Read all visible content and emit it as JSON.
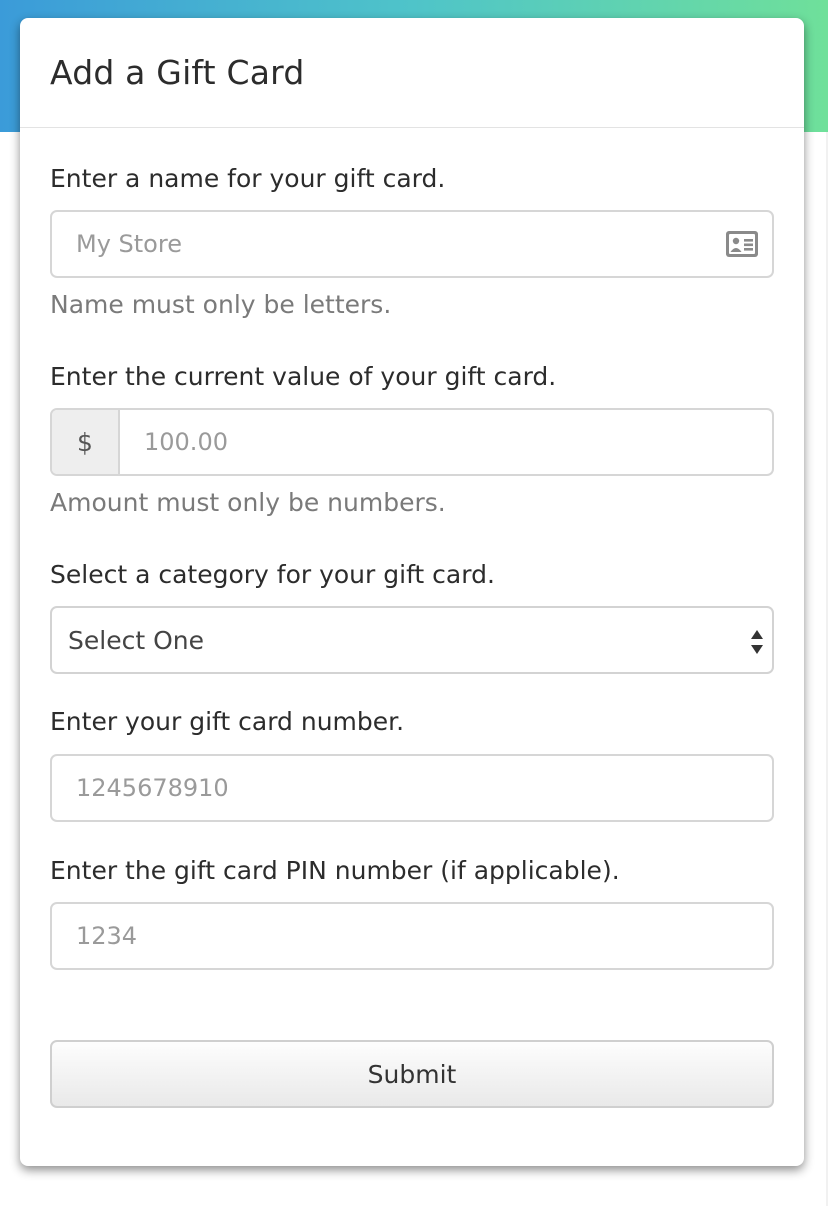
{
  "card": {
    "title": "Add a Gift Card"
  },
  "form": {
    "name": {
      "label": "Enter a name for your gift card.",
      "placeholder": "My Store",
      "icon": "id-card-icon",
      "help": "Name must only be letters."
    },
    "value": {
      "label": "Enter the current value of your gift card.",
      "addon": "$",
      "placeholder": "100.00",
      "help": "Amount must only be numbers."
    },
    "category": {
      "label": "Select a category for your gift card.",
      "selected": "Select One"
    },
    "number": {
      "label": "Enter your gift card number.",
      "placeholder": "1245678910"
    },
    "pin": {
      "label": "Enter the gift card PIN number (if applicable).",
      "placeholder": "1234"
    },
    "submit_label": "Submit"
  },
  "colors": {
    "gradient_start": "#3b9bd9",
    "gradient_end": "#6fe09a",
    "border": "#d6d6d6",
    "help_text": "#7a7a7a"
  }
}
